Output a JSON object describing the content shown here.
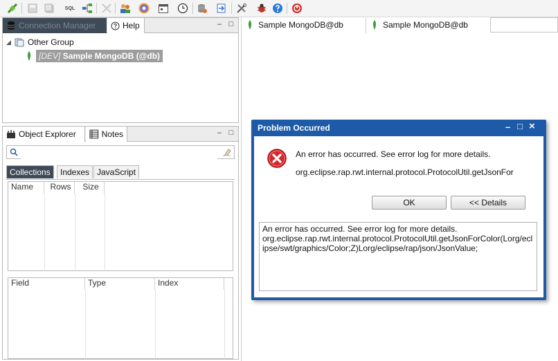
{
  "toolbar": {
    "icons": [
      "connect-icon",
      "save-icon",
      "save-all-icon",
      "sql-icon",
      "hierarchy-icon",
      "disconnect-icon",
      "users-icon",
      "stamp-icon",
      "calendar-icon",
      "history-icon",
      "database-export-icon",
      "database-import-icon",
      "tools-icon",
      "bug-icon",
      "help-icon",
      "stop-icon"
    ],
    "sql_label": "SQL"
  },
  "connection_manager": {
    "tab_label": "Connection Manager",
    "help_tab_label": "Help",
    "group_label": "Other Group",
    "item_prefix": "[DEV]",
    "item_label": "Sample MongoDB (@db)"
  },
  "editor_tabs": [
    "Sample MongoDB@db",
    "Sample MongoDB@db"
  ],
  "object_explorer": {
    "tab_label": "Object Explorer",
    "notes_tab_label": "Notes",
    "search_placeholder": "",
    "subtabs": [
      "Collections",
      "Indexes",
      "JavaScript"
    ],
    "collection_columns": [
      "Name",
      "Rows",
      "Size"
    ],
    "field_columns": [
      "Field",
      "Type",
      "Index"
    ]
  },
  "dialog": {
    "title": "Problem Occurred",
    "message": "An error has occurred. See error log for more details.",
    "detail_line": "org.eclipse.rap.rwt.internal.protocol.ProtocolUtil.getJsonFor",
    "ok_label": "OK",
    "details_label": "<< Details",
    "details_text": "An error has occurred. See error log for more details.\norg.eclipse.rap.rwt.internal.protocol.ProtocolUtil.getJsonForColor(Lorg/eclipse/swt/graphics/Color;Z)Lorg/eclipse/rap/json/JsonValue;",
    "min_symbol": "–",
    "max_symbol": "□",
    "close_symbol": "×"
  },
  "colors": {
    "dialog_title_bar": "#1d5aa7",
    "error_red": "#d9262b",
    "mongo_leaf": "#3f9b3a",
    "tab_active_dark": "#3f4a57"
  }
}
